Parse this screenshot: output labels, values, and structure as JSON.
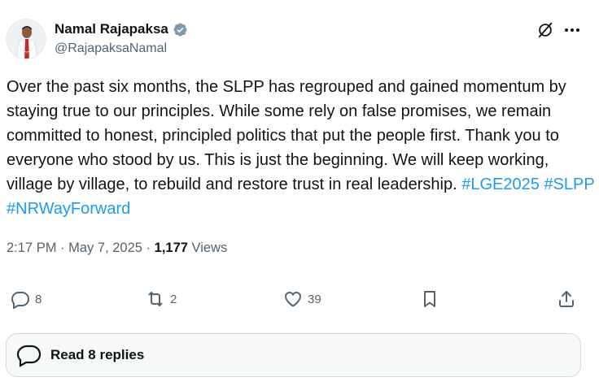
{
  "author": {
    "display_name": "Namal Rajapaksa",
    "handle": "@RajapaksaNamal",
    "verified": true
  },
  "post": {
    "text": "Over the past six months, the SLPP has regrouped and gained momentum by staying true to our principles. While some rely on false promises, we remain committed to honest, principled politics that put the people first. Thank you to everyone who stood by us. This is just the beginning. We will keep working, village by village, to rebuild and restore trust in real leadership. ",
    "hashtags": [
      "#LGE2025",
      "#SLPP",
      "#NRWayForward"
    ],
    "time": "2:17 PM",
    "separator": "·",
    "date": "May 7, 2025",
    "views_count": "1,177",
    "views_label": "Views"
  },
  "actions": {
    "replies": "8",
    "reposts": "2",
    "likes": "39"
  },
  "read_replies": {
    "label": "Read 8 replies"
  },
  "colors": {
    "accent": "#1d9bf0",
    "text": "#0f1419",
    "muted": "#536471",
    "border": "#cfd9de"
  },
  "icons": [
    "verified-badge-icon",
    "grok-icon",
    "more-icon",
    "reply-icon",
    "repost-icon",
    "like-icon",
    "bookmark-icon",
    "share-icon",
    "comment-bubble-icon"
  ]
}
